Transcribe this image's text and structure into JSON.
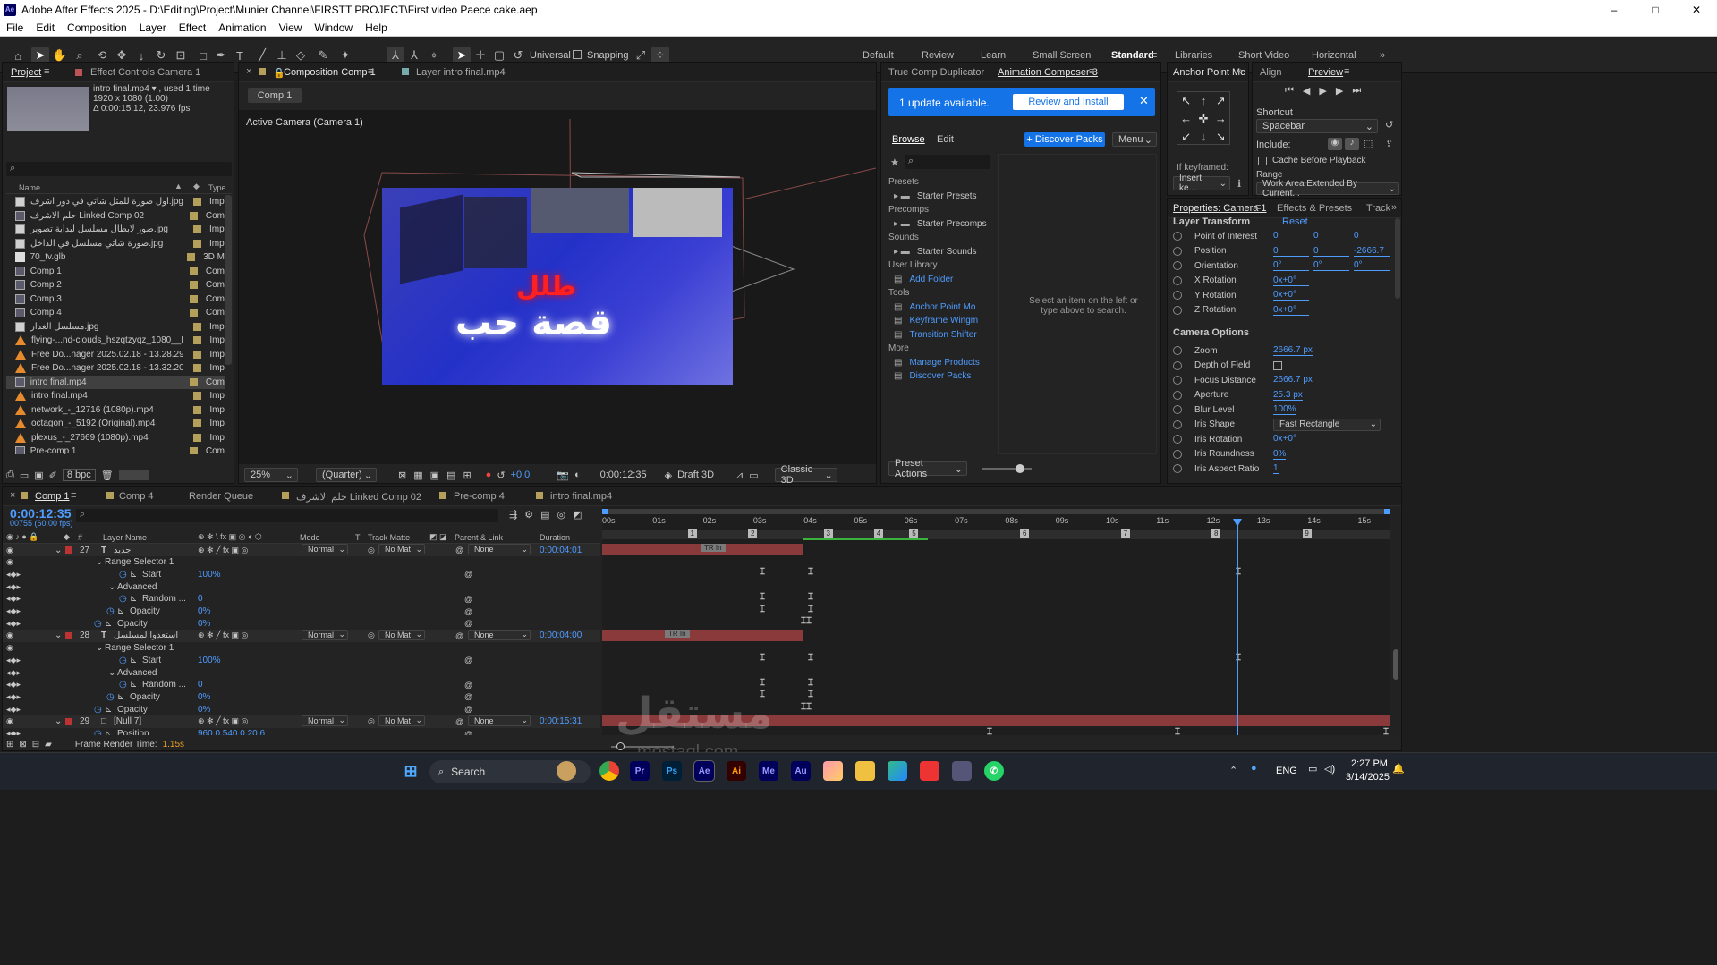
{
  "window": {
    "title": "Adobe After Effects 2025 - D:\\Editing\\Project\\Munier Channel\\FIRSTT PROJECT\\First video Paece cake.aep",
    "app_icon": "Ae",
    "controls": [
      "–",
      "□",
      "✕"
    ]
  },
  "menu": [
    "File",
    "Edit",
    "Composition",
    "Layer",
    "Effect",
    "Animation",
    "View",
    "Window",
    "Help"
  ],
  "toolbar": {
    "universal": "Universal",
    "snapping": "Snapping"
  },
  "workspaces": [
    "Default",
    "Review",
    "Learn",
    "Small Screen",
    "Standard",
    "Libraries",
    "Short Video",
    "Horizontal"
  ],
  "workspace_active": "Standard",
  "project": {
    "tab": "Project",
    "tab2": "Effect Controls Camera 1",
    "selected_name": "intro final.mp4 ▾ , used 1 time",
    "selected_size": "1920 x 1080 (1.00)",
    "selected_duration": "Δ 0:00:15:12, 23.976 fps",
    "col_name": "Name",
    "col_type": "Type",
    "items": [
      {
        "name": "أول صورة للمثل شاتي في دور اشرف.jpg",
        "type": "Imp",
        "icon": "img"
      },
      {
        "name": "حلم الاشرف Linked Comp 02",
        "type": "Com",
        "icon": "comp"
      },
      {
        "name": "صور لابطال مسلسل لبداية تصوير.jpg",
        "type": "Imp",
        "icon": "img"
      },
      {
        "name": "صورة شاتي مسلسل في الداخل.jpg",
        "type": "Imp",
        "icon": "img"
      },
      {
        "name": "70_tv.glb",
        "type": "3D M",
        "icon": "file"
      },
      {
        "name": "Comp 1",
        "type": "Com",
        "icon": "comp"
      },
      {
        "name": "Comp 2",
        "type": "Com",
        "icon": "comp"
      },
      {
        "name": "Comp 3",
        "type": "Com",
        "icon": "comp"
      },
      {
        "name": "Comp 4",
        "type": "Com",
        "icon": "comp"
      },
      {
        "name": "مسلسل الغدار.jpg",
        "type": "Imp",
        "icon": "img"
      },
      {
        "name": "flying-...nd-clouds_hszqtzyqz_1080__D.mp4",
        "type": "Imp",
        "icon": "vid"
      },
      {
        "name": "Free Do...nager 2025.02.18 - 13.28.29.02.mp4",
        "type": "Imp",
        "icon": "vid"
      },
      {
        "name": "Free Do...nager 2025.02.18 - 13.32.20.07.mp4",
        "type": "Imp",
        "icon": "vid"
      },
      {
        "name": "intro final.mp4",
        "type": "Com",
        "icon": "comp"
      },
      {
        "name": "intro final.mp4",
        "type": "Imp",
        "icon": "vid"
      },
      {
        "name": "network_-_12716 (1080p).mp4",
        "type": "Imp",
        "icon": "vid"
      },
      {
        "name": "octagon_-_5192 (Original).mp4",
        "type": "Imp",
        "icon": "vid"
      },
      {
        "name": "plexus_-_27669 (1080p).mp4",
        "type": "Imp",
        "icon": "vid"
      },
      {
        "name": "Pre-comp 1",
        "type": "Com",
        "icon": "comp"
      }
    ],
    "bpc": "8 bpc"
  },
  "comp_viewer": {
    "tab": "Composition Comp 1",
    "tab_layer": "Layer intro final.mp4",
    "breadcrumb": "Comp 1",
    "camera_label": "Active Camera (Camera 1)",
    "red_text": "طلل",
    "white_text": "قصة حب",
    "zoom": "25%",
    "resolution": "(Quarter)",
    "exposure": "+0.0",
    "timecode": "0:00:12:35",
    "renderer": "Draft 3D",
    "renderer_mode": "Classic 3D"
  },
  "ac_panel": {
    "tab1": "True Comp Duplicator",
    "tab2": "Animation Composer 3",
    "update": "1 update available.",
    "review": "Review and Install",
    "browse": "Browse",
    "edit": "Edit",
    "discover": "+ Discover Packs",
    "menu": "Menu",
    "sections": [
      {
        "header": "Presets",
        "items": [
          "Starter Presets"
        ]
      },
      {
        "header": "Precomps",
        "items": [
          "Starter Precomps"
        ]
      },
      {
        "header": "Sounds",
        "items": [
          "Starter Sounds"
        ]
      },
      {
        "header": "User Library",
        "items": [
          "Add Folder"
        ]
      },
      {
        "header": "Tools",
        "items": [
          "Anchor Point Mo",
          "Keyframe Wingm",
          "Transition Shifter"
        ]
      },
      {
        "header": "More",
        "items": [
          "Manage Products",
          "Discover Packs"
        ]
      }
    ],
    "empty_hint": "Select an item on the left or type above to search.",
    "preset_actions": "Preset Actions"
  },
  "anchor_panel": {
    "tab": "Anchor Point Mc",
    "if_keyframed": "If keyframed:",
    "insert": "Insert ke..."
  },
  "preview": {
    "tab_align": "Align",
    "tab": "Preview",
    "shortcut_label": "Shortcut",
    "shortcut": "Spacebar",
    "include": "Include:",
    "cache": "Cache Before Playback",
    "range_label": "Range",
    "range": "Work Area Extended By Current..."
  },
  "properties": {
    "tab": "Properties: Camera 1",
    "tab2": "Effects & Presets",
    "tab3": "Track",
    "layer_transform": "Layer Transform",
    "reset": "Reset",
    "transform": [
      {
        "label": "Point of Interest",
        "v": [
          "0",
          "0",
          "0"
        ]
      },
      {
        "label": "Position",
        "v": [
          "0",
          "0",
          "-2666.7"
        ]
      },
      {
        "label": "Orientation",
        "v": [
          "0°",
          "0°",
          "0°"
        ]
      },
      {
        "label": "X Rotation",
        "v": [
          "0x+0°"
        ]
      },
      {
        "label": "Y Rotation",
        "v": [
          "0x+0°"
        ]
      },
      {
        "label": "Z Rotation",
        "v": [
          "0x+0°"
        ]
      }
    ],
    "camera_options": "Camera Options",
    "camera": [
      {
        "label": "Zoom",
        "v": "2666.7 px"
      },
      {
        "label": "Depth of Field",
        "v": ""
      },
      {
        "label": "Focus Distance",
        "v": "2666.7 px"
      },
      {
        "label": "Aperture",
        "v": "25.3 px"
      },
      {
        "label": "Blur Level",
        "v": "100%"
      },
      {
        "label": "Iris Shape",
        "v": "Fast Rectangle"
      },
      {
        "label": "Iris Rotation",
        "v": "0x+0°"
      },
      {
        "label": "Iris Roundness",
        "v": "0%"
      },
      {
        "label": "Iris Aspect Ratio",
        "v": "1"
      }
    ]
  },
  "timeline": {
    "tabs": [
      "Comp 1",
      "Comp 4",
      "Render Queue",
      "حلم الاشرف Linked Comp 02",
      "Pre-comp 4",
      "intro final.mp4"
    ],
    "timecode": "0:00:12:35",
    "frames": "00755 (60.00 fps)",
    "cols": {
      "layer_name": "Layer Name",
      "mode": "Mode",
      "t": "T",
      "track_matte": "Track Matte",
      "parent": "Parent & Link",
      "duration": "Duration"
    },
    "ruler": [
      "00s",
      "01s",
      "02s",
      "03s",
      "04s",
      "05s",
      "06s",
      "07s",
      "08s",
      "09s",
      "10s",
      "11s",
      "12s",
      "13s",
      "14s",
      "15s"
    ],
    "markers": [
      "1",
      "2",
      "3",
      "4",
      "5",
      "6",
      "7",
      "8",
      "9"
    ],
    "rows": [
      {
        "kind": "layer",
        "num": "27",
        "name": "جديد",
        "mode": "Normal",
        "matte": "No Mat",
        "parent": "None",
        "dur": "0:00:04:01",
        "bar": "TR In"
      },
      {
        "kind": "prop",
        "indent": 1,
        "name": "Range Selector 1"
      },
      {
        "kind": "prop",
        "indent": 3,
        "name": "Start",
        "val": "100%"
      },
      {
        "kind": "prop",
        "indent": 2,
        "name": "Advanced"
      },
      {
        "kind": "prop",
        "indent": 3,
        "name": "Random ...",
        "val": "0"
      },
      {
        "kind": "prop",
        "indent": 2,
        "name": "Opacity",
        "val": "0%"
      },
      {
        "kind": "prop",
        "indent": 1,
        "name": "Opacity",
        "val": "0%"
      },
      {
        "kind": "layer",
        "num": "28",
        "name": "استعدوا لمسلسل",
        "mode": "Normal",
        "matte": "No Mat",
        "parent": "None",
        "dur": "0:00:04:00",
        "bar": "TR In"
      },
      {
        "kind": "prop",
        "indent": 1,
        "name": "Range Selector 1"
      },
      {
        "kind": "prop",
        "indent": 3,
        "name": "Start",
        "val": "100%"
      },
      {
        "kind": "prop",
        "indent": 2,
        "name": "Advanced"
      },
      {
        "kind": "prop",
        "indent": 3,
        "name": "Random ...",
        "val": "0"
      },
      {
        "kind": "prop",
        "indent": 2,
        "name": "Opacity",
        "val": "0%"
      },
      {
        "kind": "prop",
        "indent": 1,
        "name": "Opacity",
        "val": "0%"
      },
      {
        "kind": "layer",
        "num": "29",
        "name": "[Null 7]",
        "mode": "Normal",
        "matte": "No Mat",
        "parent": "None",
        "dur": "0:00:15:31",
        "bar": ""
      },
      {
        "kind": "prop",
        "indent": 1,
        "name": "Position",
        "val": "960.0,540.0,20.6"
      }
    ],
    "frame_render": "Frame Render Time:",
    "frame_render_val": "1.15s"
  },
  "watermark": {
    "text": "مستقل",
    "sub": "mostaql.com"
  },
  "taskbar": {
    "search": "Search",
    "lang": "ENG",
    "time": "2:27 PM",
    "date": "3/14/2025",
    "apps": [
      "Pr",
      "Ps",
      "Ae",
      "Ai",
      "Me",
      "Au"
    ]
  }
}
